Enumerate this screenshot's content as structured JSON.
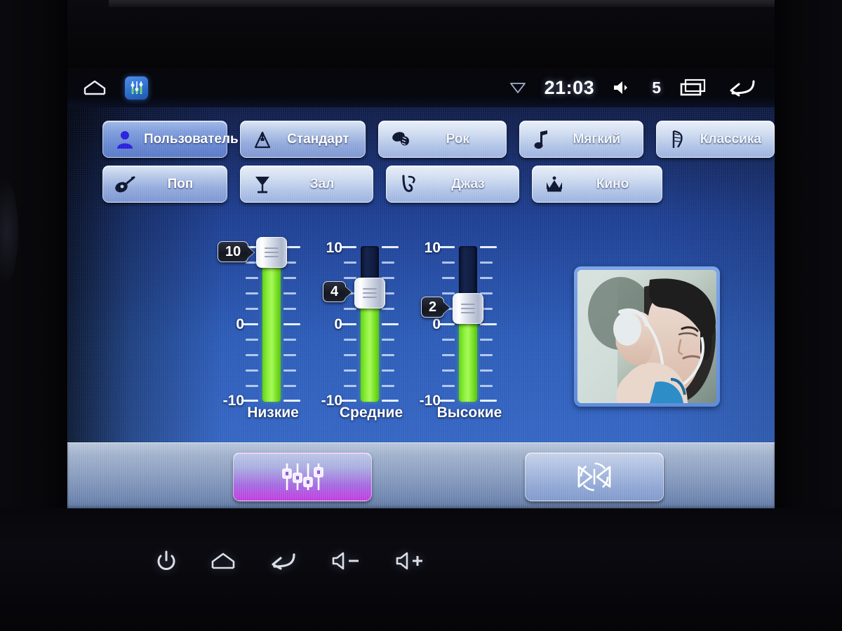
{
  "device": {
    "status_bar": {
      "home_icon": "home-icon",
      "app_icon": "equalizer-app-icon",
      "signal_icon": "wifi-signal-icon",
      "clock": "21:03",
      "volume_icon": "speaker-icon",
      "volume_value": "5",
      "recents_icon": "recents-icon",
      "back_icon": "back-arrow-icon"
    },
    "hardware_keys": [
      {
        "name": "power-key",
        "icon": "power-icon"
      },
      {
        "name": "home-key",
        "icon": "home-icon"
      },
      {
        "name": "back-key",
        "icon": "back-arrow-icon"
      },
      {
        "name": "volume-down-key",
        "icon": "volume-down-icon"
      },
      {
        "name": "volume-up-key",
        "icon": "volume-up-icon"
      }
    ],
    "rotary_knob": "volume-knob"
  },
  "presets": {
    "row1": [
      {
        "label": "Пользователь",
        "icon": "user-icon",
        "selected": true
      },
      {
        "label": "Стандарт",
        "icon": "metronome-icon",
        "selected": false
      },
      {
        "label": "Рок",
        "icon": "drum-icon",
        "selected": false
      },
      {
        "label": "Мягкий",
        "icon": "music-note-icon",
        "selected": false
      },
      {
        "label": "Классика",
        "icon": "harp-icon",
        "selected": false
      }
    ],
    "row2": [
      {
        "label": "Поп",
        "icon": "guitar-icon",
        "selected": false
      },
      {
        "label": "Зал",
        "icon": "cocktail-glass-icon",
        "selected": false
      },
      {
        "label": "Джаз",
        "icon": "saxophone-icon",
        "selected": false
      },
      {
        "label": "Кино",
        "icon": "crown-icon",
        "selected": false
      }
    ]
  },
  "equalizer": {
    "scale": {
      "max": "10",
      "mid": "0",
      "min": "-10"
    },
    "bands": [
      {
        "name": "Низкие",
        "value": "10",
        "value_num": 10
      },
      {
        "name": "Средние",
        "value": "4",
        "value_num": 4
      },
      {
        "name": "Высокие",
        "value": "2",
        "value_num": 2
      }
    ],
    "range": [
      -10,
      10
    ]
  },
  "album_art": {
    "alt": "person-listening-headphones-photo"
  },
  "toolbar": {
    "equalizer_button": {
      "label": "",
      "icon": "equalizer-sliders-icon",
      "active": true
    },
    "balance_button": {
      "label": "",
      "icon": "balance-fader-icon",
      "active": false
    }
  },
  "colors": {
    "screen_blue": "#2c5cb8",
    "fill_green": "#8cf03a",
    "accent_purple": "#c43ce0",
    "selected_blue": "#6585d0"
  }
}
